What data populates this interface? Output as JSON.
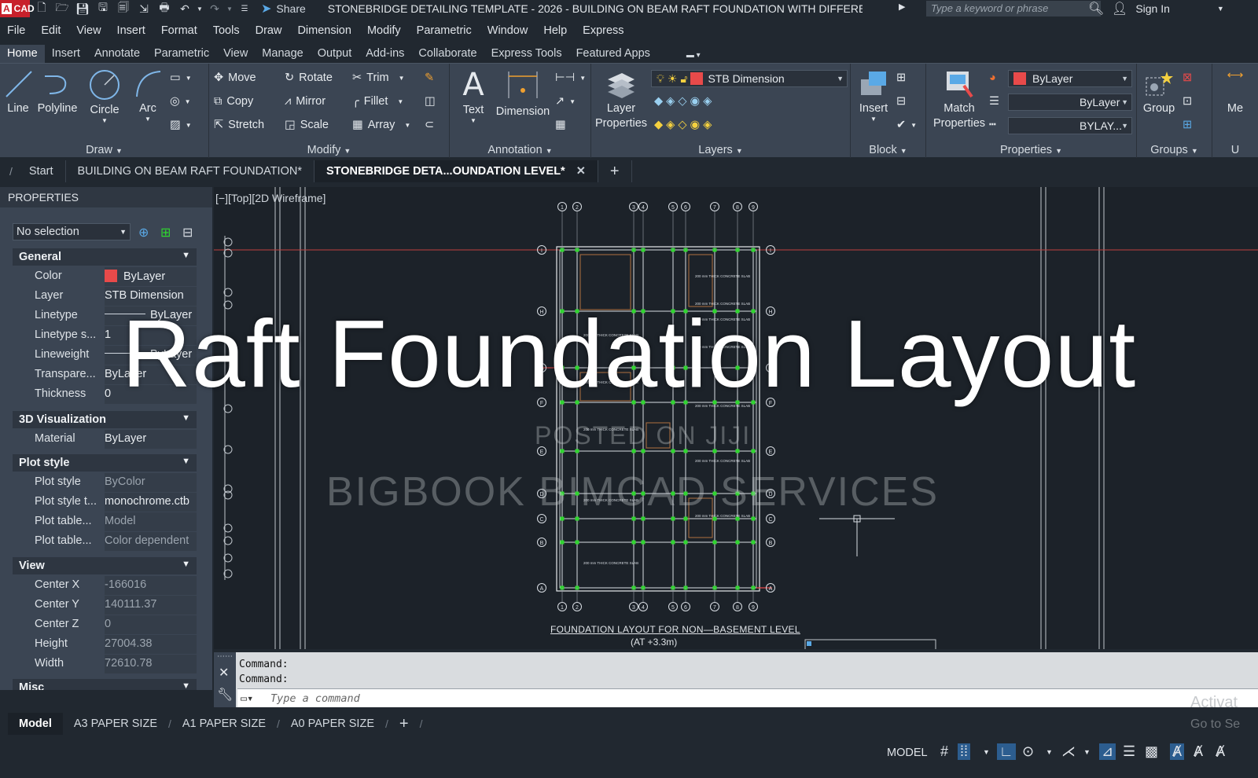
{
  "titlebar": {
    "app_badge": "CAD",
    "share_label": "Share",
    "title": "STONEBRIDGE DETAILING TEMPLATE - 2026 - BUILDING ON BEAM RAFT FOUNDATION WITH DIFFERE...",
    "search_placeholder": "Type a keyword or phrase",
    "signin_label": "Sign In"
  },
  "menubar": [
    "File",
    "Edit",
    "View",
    "Insert",
    "Format",
    "Tools",
    "Draw",
    "Dimension",
    "Modify",
    "Parametric",
    "Window",
    "Help",
    "Express"
  ],
  "ribbon_tabs": [
    "Home",
    "Insert",
    "Annotate",
    "Parametric",
    "View",
    "Manage",
    "Output",
    "Add-ins",
    "Collaborate",
    "Express Tools",
    "Featured Apps"
  ],
  "ribbon": {
    "draw": {
      "title": "Draw",
      "line": "Line",
      "polyline": "Polyline",
      "circle": "Circle",
      "arc": "Arc"
    },
    "modify": {
      "title": "Modify",
      "move": "Move",
      "rotate": "Rotate",
      "trim": "Trim",
      "copy": "Copy",
      "mirror": "Mirror",
      "fillet": "Fillet",
      "stretch": "Stretch",
      "scale": "Scale",
      "array": "Array"
    },
    "annotation": {
      "title": "Annotation",
      "text": "Text",
      "dimension": "Dimension"
    },
    "layers": {
      "title": "Layers",
      "layer_properties_1": "Layer",
      "layer_properties_2": "Properties",
      "current_layer": "STB Dimension"
    },
    "block": {
      "title": "Block",
      "insert": "Insert"
    },
    "properties": {
      "title": "Properties",
      "match_1": "Match",
      "match_2": "Properties",
      "color": "ByLayer",
      "lineweight": "ByLayer",
      "linetype": "BYLAY..."
    },
    "groups": {
      "title": "Groups",
      "group": "Group"
    },
    "cut_label": "Me",
    "cut_title": "U"
  },
  "doc_tabs": [
    "Start",
    "BUILDING ON BEAM RAFT FOUNDATION*",
    "STONEBRIDGE DETA...OUNDATION LEVEL*"
  ],
  "properties_palette": {
    "title": "PROPERTIES",
    "selection": "No selection",
    "sections": {
      "general": "General",
      "viz3d": "3D Visualization",
      "plot": "Plot style",
      "view": "View",
      "misc": "Misc"
    },
    "general_rows": [
      {
        "k": "Color",
        "v": "ByLayer"
      },
      {
        "k": "Layer",
        "v": "STB Dimension"
      },
      {
        "k": "Linetype",
        "v": "ByLayer"
      },
      {
        "k": "Linetype s...",
        "v": "1"
      },
      {
        "k": "Lineweight",
        "v": "ByLayer"
      },
      {
        "k": "Transpare...",
        "v": "ByLayer"
      },
      {
        "k": "Thickness",
        "v": "0"
      }
    ],
    "viz_rows": [
      {
        "k": "Material",
        "v": "ByLayer"
      }
    ],
    "plot_rows": [
      {
        "k": "Plot style",
        "v": "ByColor"
      },
      {
        "k": "Plot style t...",
        "v": "monochrome.ctb"
      },
      {
        "k": "Plot table...",
        "v": "Model"
      },
      {
        "k": "Plot table...",
        "v": "Color dependent"
      }
    ],
    "view_rows": [
      {
        "k": "Center X",
        "v": "-166016"
      },
      {
        "k": "Center Y",
        "v": "140111.37"
      },
      {
        "k": "Center Z",
        "v": "0"
      },
      {
        "k": "Height",
        "v": "27004.38"
      },
      {
        "k": "Width",
        "v": "72610.78"
      }
    ]
  },
  "viewport": {
    "label": "[−][Top][2D Wireframe]",
    "drawing_title": "FOUNDATION LAYOUT FOR NON—BASEMENT LEVEL",
    "drawing_subtitle": "(AT +3.3m)",
    "slab_label": "200 mm THICK CONCRETE SLAB",
    "top_grid": [
      "1",
      "2",
      "3",
      "4",
      "5",
      "6",
      "7",
      "8",
      "9"
    ],
    "left_grid": [
      "I",
      "H",
      "G",
      "F",
      "E",
      "D",
      "C",
      "B",
      "A"
    ]
  },
  "overlay_title": "Raft Foundation Layout",
  "watermark_1": "POSTED ON JIJI",
  "watermark_2": "BIGBOOK BIMCAD SERVICES",
  "command": {
    "history_1": "Command:",
    "history_2": "Command:",
    "placeholder": "Type a command"
  },
  "layout_tabs": [
    "Model",
    "A3 PAPER SIZE",
    "A1 PAPER SIZE",
    "A0 PAPER SIZE"
  ],
  "status": {
    "model": "MODEL"
  },
  "activate": {
    "line1": "Activat",
    "line2": "Go to Se"
  },
  "colors": {
    "accent_red": "#e84a4a",
    "grid_green": "#2fd62f",
    "bg_dark": "#1c2229",
    "panel": "#3b4553"
  }
}
